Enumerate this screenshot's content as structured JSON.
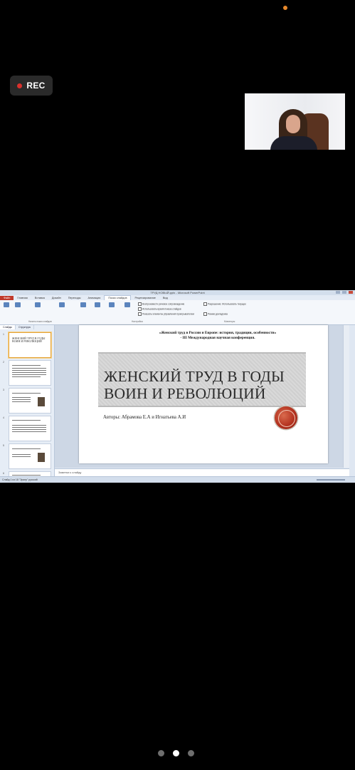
{
  "recording": {
    "label": "REC"
  },
  "window": {
    "title": "ТРУД НОВЫЙ.pptx - Microsoft PowerPoint"
  },
  "ribbon": {
    "tabs": [
      "Файл",
      "Главная",
      "Вставка",
      "Дизайн",
      "Переходы",
      "Анимация",
      "Показ слайдов",
      "Рецензирование",
      "Вид"
    ],
    "active_tab": "Показ слайдов",
    "group_labels": [
      "Начать показ слайдов",
      "Настройка",
      "Мониторы"
    ],
    "checkboxes": [
      "Воспроизвести речевое сопровождение",
      "Использовать время показа слайдов",
      "Показать элементы управления проигрывателем"
    ],
    "monitor_label": "Разрешение: Использовать текущее",
    "presenter_view": "Режим докладчика"
  },
  "slides_panel": {
    "tabs": [
      "Слайды",
      "Структура"
    ],
    "numbers": [
      "1",
      "2",
      "3",
      "4",
      "5",
      "6"
    ]
  },
  "slide": {
    "conference_line1": "«Женский труд в России и Европе: история, традиции, особенности»",
    "conference_line2": "- III Международная научная конференция.",
    "title_line1": "ЖЕНСКИЙ ТРУД В ГОДЫ",
    "title_line2": "ВОИН И РЕВОЛЮЦИЙ",
    "authors": "Авторы:  Абрамова Е.А и Игнатьева  А.И"
  },
  "thumbnails": {
    "slide1_title": "ЖЕНСКИЙ ТРУД В ГОДЫ ВОИН И РЕВОЛЮЦИЙ"
  },
  "notes": {
    "placeholder": "Заметки к слайду"
  },
  "statusbar": {
    "text": "Слайд 1 из 18   \"Эркер\"   русский"
  }
}
